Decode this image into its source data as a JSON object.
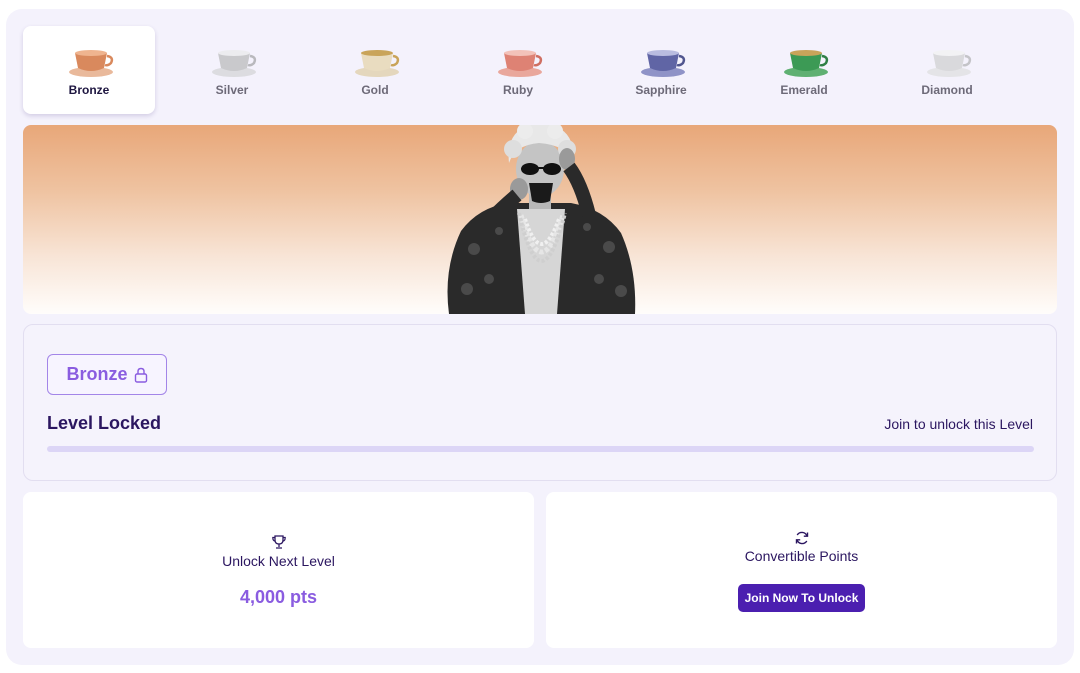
{
  "tabs": [
    {
      "label": "Bronze",
      "icon": "bronze-teacup-icon",
      "cup_color": "#d9895d",
      "saucer_color": "#e9b99b",
      "active": true
    },
    {
      "label": "Silver",
      "icon": "silver-teacup-icon",
      "cup_color": "#c9c9cc",
      "saucer_color": "#dcdce0",
      "active": false
    },
    {
      "label": "Gold",
      "icon": "gold-teacup-icon",
      "cup_color": "#e9dcc0",
      "saucer_color": "#e4d7bd",
      "active": false
    },
    {
      "label": "Ruby",
      "icon": "ruby-teacup-icon",
      "cup_color": "#de8274",
      "saucer_color": "#e9a79c",
      "active": false
    },
    {
      "label": "Sapphire",
      "icon": "sapphire-teacup-icon",
      "cup_color": "#6065a5",
      "saucer_color": "#8f93c7",
      "active": false
    },
    {
      "label": "Emerald",
      "icon": "emerald-teacup-icon",
      "cup_color": "#3c9a55",
      "saucer_color": "#5fb072",
      "active": false
    },
    {
      "label": "Diamond",
      "icon": "diamond-teacup-icon",
      "cup_color": "#d9d9dc",
      "saucer_color": "#e4e4e7",
      "active": false
    }
  ],
  "banner": {
    "figure": "grandma-sunglasses-teacup-figure",
    "gradient_top": "#e8a779",
    "gradient_bottom": "#fffdfb"
  },
  "level": {
    "badge_label": "Bronze",
    "badge_icon": "lock-icon",
    "title": "Level Locked",
    "hint": "Join to unlock this Level",
    "progress": 0
  },
  "cards": {
    "next_level": {
      "icon": "trophy-icon",
      "title": "Unlock Next Level",
      "value": "4,000 pts"
    },
    "points": {
      "icon": "refresh-icon",
      "title": "Convertible Points",
      "button_label": "Join Now To Unlock"
    }
  },
  "colors": {
    "accent": "#8a5ce0",
    "button": "#4b1fb0",
    "text": "#2b1660",
    "panel_bg": "#f4f2fc"
  }
}
